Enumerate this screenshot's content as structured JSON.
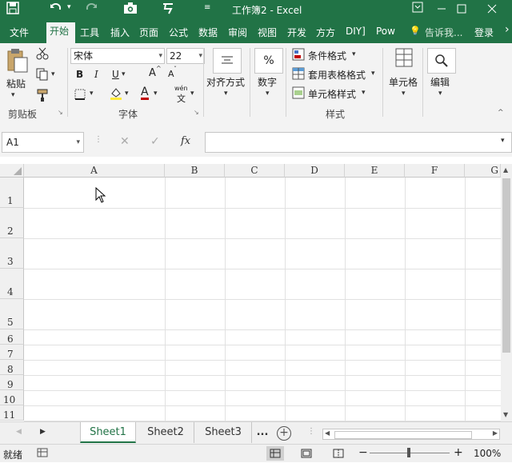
{
  "titlebar": {
    "title": "工作簿2 - Excel",
    "save_icon": "save-icon",
    "undo_icon": "undo-icon",
    "redo_icon": "redo-icon",
    "camera_icon": "camera-icon",
    "touch_icon": "touch-mode-icon",
    "customize_icon": "customize-qat-icon",
    "ribbon_opts_icon": "ribbon-display-icon",
    "minimize_icon": "minimize-icon",
    "restore_icon": "restore-icon",
    "close_icon": "close-icon"
  },
  "tabs": {
    "file": "文件",
    "home": "开始",
    "tools": "工具",
    "insert": "插入",
    "layout": "页面",
    "formulas": "公式",
    "data": "数据",
    "review": "审阅",
    "view": "视图",
    "developer": "开发",
    "fangfang": "方方",
    "diy": "DIY]",
    "power": "Pow",
    "tellme": "告诉我...",
    "login": "登录"
  },
  "ribbon": {
    "clipboard": {
      "paste": "粘贴",
      "group": "剪贴板"
    },
    "font": {
      "name": "宋体",
      "size": "22",
      "bold": "B",
      "italic": "I",
      "underline": "U",
      "grow": "A",
      "shrink": "A",
      "font_color": "A",
      "phonetic": "wén",
      "phonetic_char": "文",
      "group": "字体"
    },
    "alignment": {
      "label": "对齐方式"
    },
    "number": {
      "symbol": "%",
      "label": "数字"
    },
    "styles": {
      "cond_format": "条件格式",
      "table_format": "套用表格格式",
      "cell_styles": "单元格样式",
      "group": "样式"
    },
    "cells": {
      "label": "单元格"
    },
    "editing": {
      "label": "编辑"
    }
  },
  "formula_bar": {
    "name_box": "A1",
    "cancel": "✕",
    "enter": "✓",
    "fx": "fx",
    "value": ""
  },
  "grid": {
    "columns": [
      "A",
      "B",
      "C",
      "D",
      "E",
      "F",
      "G"
    ],
    "rows": [
      "1",
      "2",
      "3",
      "4",
      "5",
      "6",
      "7",
      "8",
      "9",
      "10",
      "11"
    ]
  },
  "sheets": {
    "tabs": [
      "Sheet1",
      "Sheet2",
      "Sheet3"
    ],
    "active": "Sheet1",
    "more": "...",
    "add": "+"
  },
  "status": {
    "ready": "就绪",
    "zoom_out": "−",
    "zoom_in": "+",
    "zoom": "100%"
  }
}
